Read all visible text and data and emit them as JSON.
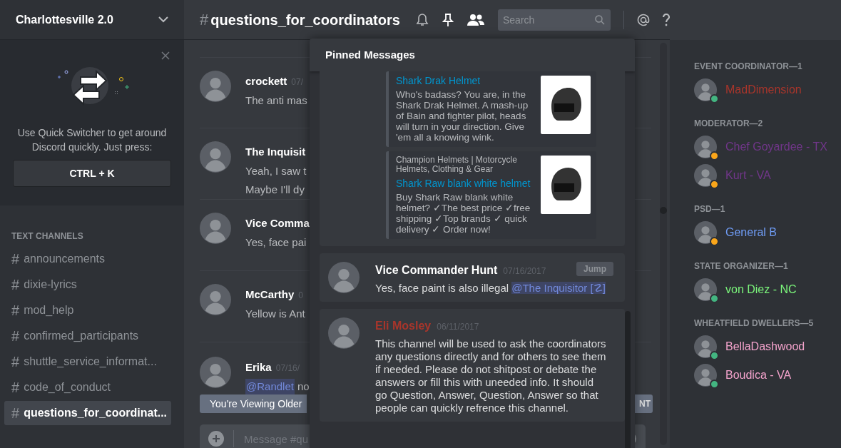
{
  "server": {
    "name": "Charlottesville 2.0"
  },
  "quick_switcher": {
    "text": "Use Quick Switcher to get around Discord quickly. Just press:",
    "shortcut": "CTRL + K"
  },
  "channel_category": "TEXT CHANNELS",
  "channels": [
    {
      "hash": "#",
      "name": "announcements",
      "selected": false
    },
    {
      "hash": "#",
      "name": "dixie-lyrics",
      "selected": false
    },
    {
      "hash": "#",
      "name": "mod_help",
      "selected": false
    },
    {
      "hash": "#",
      "name": "confirmed_participants",
      "selected": false
    },
    {
      "hash": "#",
      "name": "shuttle_service_informat...",
      "selected": false
    },
    {
      "hash": "#",
      "name": "code_of_conduct",
      "selected": false
    },
    {
      "hash": "#",
      "name": "questions_for_coordinat...",
      "selected": true
    }
  ],
  "channel_header": {
    "hash": "#",
    "name": "questions_for_coordinators",
    "search_placeholder": "Search"
  },
  "messages": [
    {
      "author": "crockett",
      "timestamp": "07/",
      "lines": [
        [
          {
            "kind": "text",
            "text": "The anti mas"
          }
        ]
      ]
    },
    {
      "author": "The Inquisit",
      "lines": [
        [
          {
            "kind": "text",
            "text": "Yeah, I saw t"
          }
        ],
        [
          {
            "kind": "text",
            "text": "Maybe I'll dy"
          }
        ]
      ]
    },
    {
      "author": "Vice Comma",
      "lines": [
        [
          {
            "kind": "text",
            "text": "Yes, face pai"
          }
        ]
      ]
    },
    {
      "author": "McCarthy",
      "timestamp": "0",
      "lines": [
        [
          {
            "kind": "text",
            "text": "Yellow is Ant"
          }
        ]
      ]
    },
    {
      "author": "Erika",
      "timestamp": "07/16/",
      "lines": [
        [
          {
            "kind": "mention",
            "text": "@Randlet"
          },
          {
            "kind": "text",
            "text": "no"
          }
        ]
      ]
    }
  ],
  "older_banner": {
    "text": "You're Viewing Older",
    "jump": "NT"
  },
  "composer": {
    "placeholder": "Message #qu"
  },
  "pinned": {
    "title": "Pinned Messages",
    "items": [
      {
        "kind": "embeds",
        "embeds": [
          {
            "title": "Shark Drak Helmet",
            "description": "Who's badass? You are, in the Shark Drak Helmet. A mash-up of Bain and fighter pilot, heads will turn in your direction. Give 'em all a knowing wink."
          },
          {
            "provider": "Champion Helmets | Motorcycle Helmets, Clothing & Gear",
            "title": "Shark Raw blank white helmet",
            "description": "Buy Shark Raw blank white helmet? ✓The best price ✓free shipping ✓Top brands ✓ quick delivery ✓ Order now!"
          }
        ]
      },
      {
        "kind": "message",
        "author": "Vice Commander Hunt",
        "color": "#ffffff",
        "date": "07/16/2017",
        "jump": "Jump",
        "body": [
          {
            "kind": "text",
            "text": "Yes, face paint is also illegal"
          },
          {
            "kind": "mention",
            "text": "@The Inquisitor [☡]"
          }
        ]
      },
      {
        "kind": "message",
        "author": "Eli Mosley",
        "color": "#a8352b",
        "date": "06/11/2017",
        "body": [
          {
            "kind": "text",
            "text": "This channel will be used to ask the coordinators any questions directly and for others to see them if needed. Please do not shitpost or debate the answers or fill this with uneeded info. It should go Question, Answer, Question, Answer so that people can quickly refrence this channel."
          }
        ]
      }
    ]
  },
  "member_groups": [
    {
      "title": "EVENT COORDINATOR—1",
      "members": [
        {
          "name": "MadDimension",
          "color": "#a8352b",
          "idle": false
        }
      ]
    },
    {
      "title": "MODERATOR—2",
      "members": [
        {
          "name": "Chef Goyardee - TX",
          "color": "#71368a",
          "idle": true
        },
        {
          "name": "Kurt - VA",
          "color": "#71368a",
          "idle": true
        }
      ]
    },
    {
      "title": "PSD—1",
      "members": [
        {
          "name": "General B",
          "color": "#6f9cf5",
          "idle": true
        }
      ]
    },
    {
      "title": "STATE ORGANIZER—1",
      "members": [
        {
          "name": "von Diez - NC",
          "color": "#7bf57b",
          "idle": false
        }
      ]
    },
    {
      "title": "WHEATFIELD DWELLERS—5",
      "members": [
        {
          "name": "BellaDashwood",
          "color": "#f4a3cc",
          "idle": false
        },
        {
          "name": "Boudica - VA",
          "color": "#f4a3cc",
          "idle": false
        }
      ]
    }
  ]
}
